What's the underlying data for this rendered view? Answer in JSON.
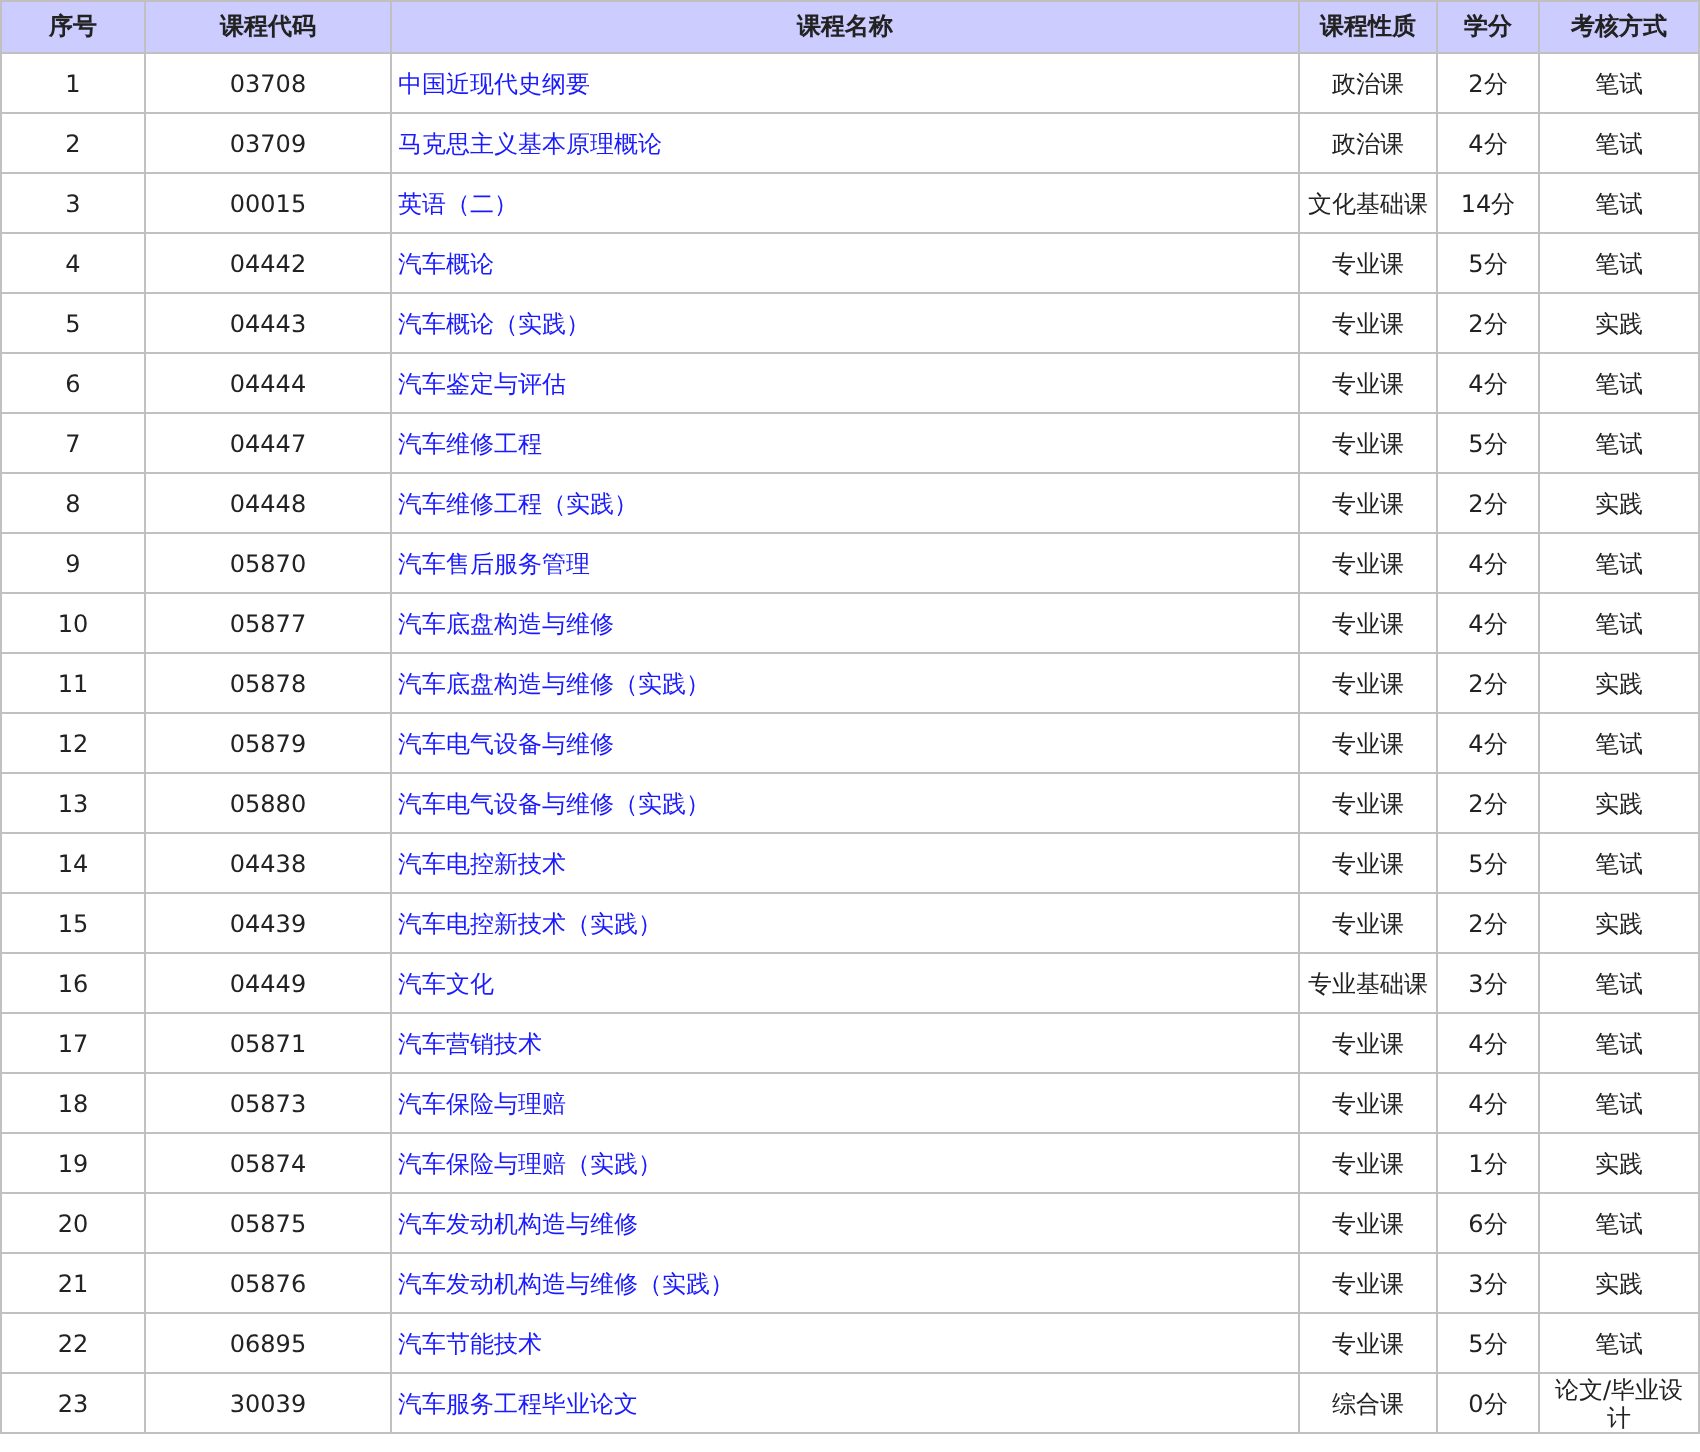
{
  "table": {
    "columns": [
      "序号",
      "课程代码",
      "课程名称",
      "课程性质",
      "学分",
      "考核方式"
    ],
    "rows": [
      [
        "1",
        "03708",
        "中国近现代史纲要",
        "政治课",
        "2分",
        "笔试"
      ],
      [
        "2",
        "03709",
        "马克思主义基本原理概论",
        "政治课",
        "4分",
        "笔试"
      ],
      [
        "3",
        "00015",
        "英语（二）",
        "文化基础课",
        "14分",
        "笔试"
      ],
      [
        "4",
        "04442",
        "汽车概论",
        "专业课",
        "5分",
        "笔试"
      ],
      [
        "5",
        "04443",
        "汽车概论（实践）",
        "专业课",
        "2分",
        "实践"
      ],
      [
        "6",
        "04444",
        "汽车鉴定与评估",
        "专业课",
        "4分",
        "笔试"
      ],
      [
        "7",
        "04447",
        "汽车维修工程",
        "专业课",
        "5分",
        "笔试"
      ],
      [
        "8",
        "04448",
        "汽车维修工程（实践）",
        "专业课",
        "2分",
        "实践"
      ],
      [
        "9",
        "05870",
        "汽车售后服务管理",
        "专业课",
        "4分",
        "笔试"
      ],
      [
        "10",
        "05877",
        "汽车底盘构造与维修",
        "专业课",
        "4分",
        "笔试"
      ],
      [
        "11",
        "05878",
        "汽车底盘构造与维修（实践）",
        "专业课",
        "2分",
        "实践"
      ],
      [
        "12",
        "05879",
        "汽车电气设备与维修",
        "专业课",
        "4分",
        "笔试"
      ],
      [
        "13",
        "05880",
        "汽车电气设备与维修（实践）",
        "专业课",
        "2分",
        "实践"
      ],
      [
        "14",
        "04438",
        "汽车电控新技术",
        "专业课",
        "5分",
        "笔试"
      ],
      [
        "15",
        "04439",
        "汽车电控新技术（实践）",
        "专业课",
        "2分",
        "实践"
      ],
      [
        "16",
        "04449",
        "汽车文化",
        "专业基础课",
        "3分",
        "笔试"
      ],
      [
        "17",
        "05871",
        "汽车营销技术",
        "专业课",
        "4分",
        "笔试"
      ],
      [
        "18",
        "05873",
        "汽车保险与理赔",
        "专业课",
        "4分",
        "笔试"
      ],
      [
        "19",
        "05874",
        "汽车保险与理赔（实践）",
        "专业课",
        "1分",
        "实践"
      ],
      [
        "20",
        "05875",
        "汽车发动机构造与维修",
        "专业课",
        "6分",
        "笔试"
      ],
      [
        "21",
        "05876",
        "汽车发动机构造与维修（实践）",
        "专业课",
        "3分",
        "实践"
      ],
      [
        "22",
        "06895",
        "汽车节能技术",
        "专业课",
        "5分",
        "笔试"
      ],
      [
        "23",
        "30039",
        "汽车服务工程毕业论文",
        "综合课",
        "0分",
        "论文/毕业设计"
      ]
    ]
  }
}
